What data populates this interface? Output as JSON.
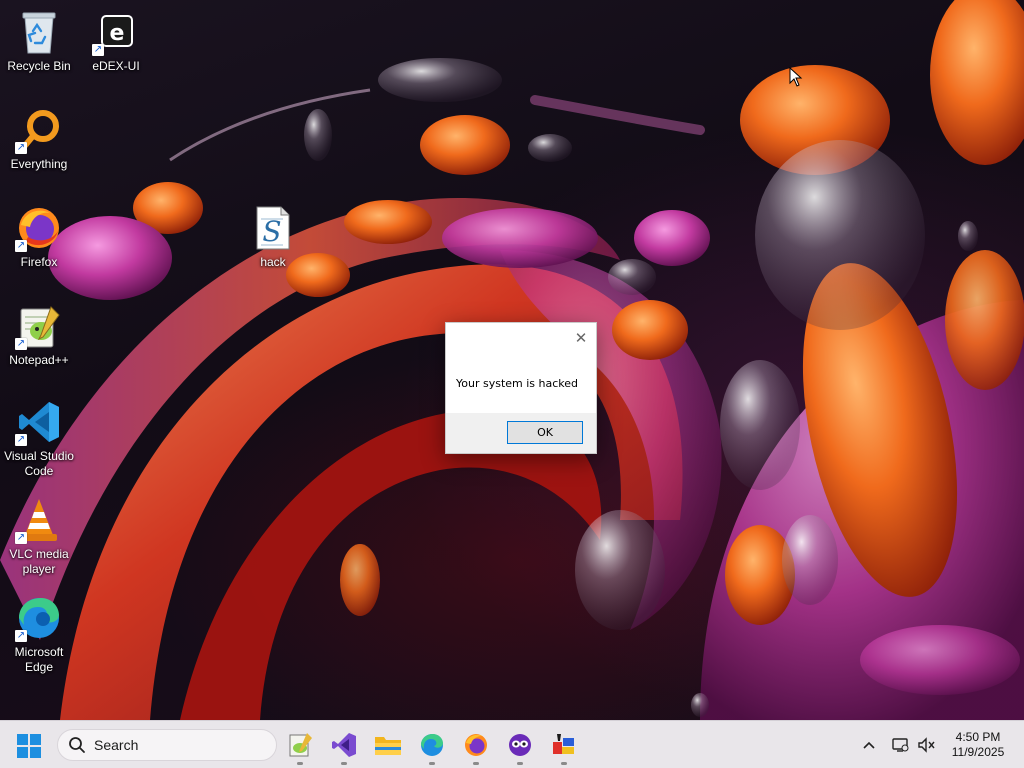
{
  "desktop": {
    "icons": [
      {
        "label": "Recycle Bin",
        "icon": "recycle-bin-icon"
      },
      {
        "label": "eDEX-UI",
        "icon": "edex-ui-icon"
      },
      {
        "label": "Everything",
        "icon": "everything-search-icon"
      },
      {
        "label": "Firefox",
        "icon": "firefox-icon"
      },
      {
        "label": "hack",
        "icon": "script-file-icon"
      },
      {
        "label": "Notepad++",
        "icon": "notepadpp-icon"
      },
      {
        "label": "Visual Studio\nCode",
        "icon": "vscode-icon"
      },
      {
        "label": "VLC media\nplayer",
        "icon": "vlc-icon"
      },
      {
        "label": "Microsoft\nEdge",
        "icon": "edge-icon"
      }
    ]
  },
  "dialog": {
    "message": "Your system is hacked",
    "ok_label": "OK",
    "close_icon": "close-icon"
  },
  "taskbar": {
    "search_placeholder": "Search",
    "pinned_apps": [
      "notepadpp-icon",
      "visual-studio-icon",
      "file-explorer-icon",
      "edge-icon",
      "firefox-icon",
      "app-masks-icon",
      "paint-app-icon"
    ],
    "tray_icons": [
      "chevron-up-icon",
      "network-icon",
      "volume-muted-icon"
    ],
    "time": "4:50 PM",
    "date": "11/9/2025"
  },
  "colors": {
    "taskbar_bg": "#e9e6ea",
    "dialog_bg": "#f0f0f0",
    "ok_border": "#0078d7",
    "wallpaper_orange": "#e8601a",
    "wallpaper_magenta": "#c23aa0"
  }
}
